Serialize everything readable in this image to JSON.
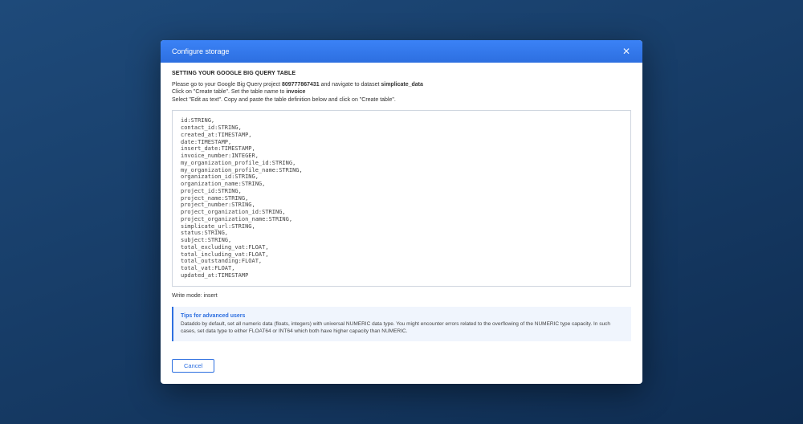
{
  "header": {
    "title": "Configure storage"
  },
  "section_title": "SETTING YOUR GOOGLE BIG QUERY TABLE",
  "intro": {
    "line1_pre": "Please go to your Google Big Query project ",
    "project_id": "809777867431",
    "line1_mid": " and navigate to dataset ",
    "dataset": "simplicate_data",
    "line2_pre": "Click on \"Create table\". Set the table name to ",
    "table_name": "invoice",
    "line3": "Select \"Edit as text\". Copy and paste the table definition below and click on \"Create table\"."
  },
  "table_def": "id:STRING,\ncontact_id:STRING,\ncreated_at:TIMESTAMP,\ndate:TIMESTAMP,\ninsert_date:TIMESTAMP,\ninvoice_number:INTEGER,\nmy_organization_profile_id:STRING,\nmy_organization_profile_name:STRING,\norganization_id:STRING,\norganization_name:STRING,\nproject_id:STRING,\nproject_name:STRING,\nproject_number:STRING,\nproject_organization_id:STRING,\nproject_organization_name:STRING,\nsimplicate_url:STRING,\nstatus:STRING,\nsubject:STRING,\ntotal_excluding_vat:FLOAT,\ntotal_including_vat:FLOAT,\ntotal_outstanding:FLOAT,\ntotal_vat:FLOAT,\nupdated_at:TIMESTAMP",
  "write_mode_label": "Write mode: ",
  "write_mode_value": "insert",
  "tip": {
    "title": "Tips for advanced users",
    "body": "Dataddo by default, set all numeric data (floats, integers) with universal NUMERIC data type. You might encounter errors related to the overflowing of the NUMERIC type capacity. In such cases, set data type to either FLOAT64 or INT64 which both have higher capacity than NUMERIC."
  },
  "footer": {
    "cancel": "Cancel"
  }
}
